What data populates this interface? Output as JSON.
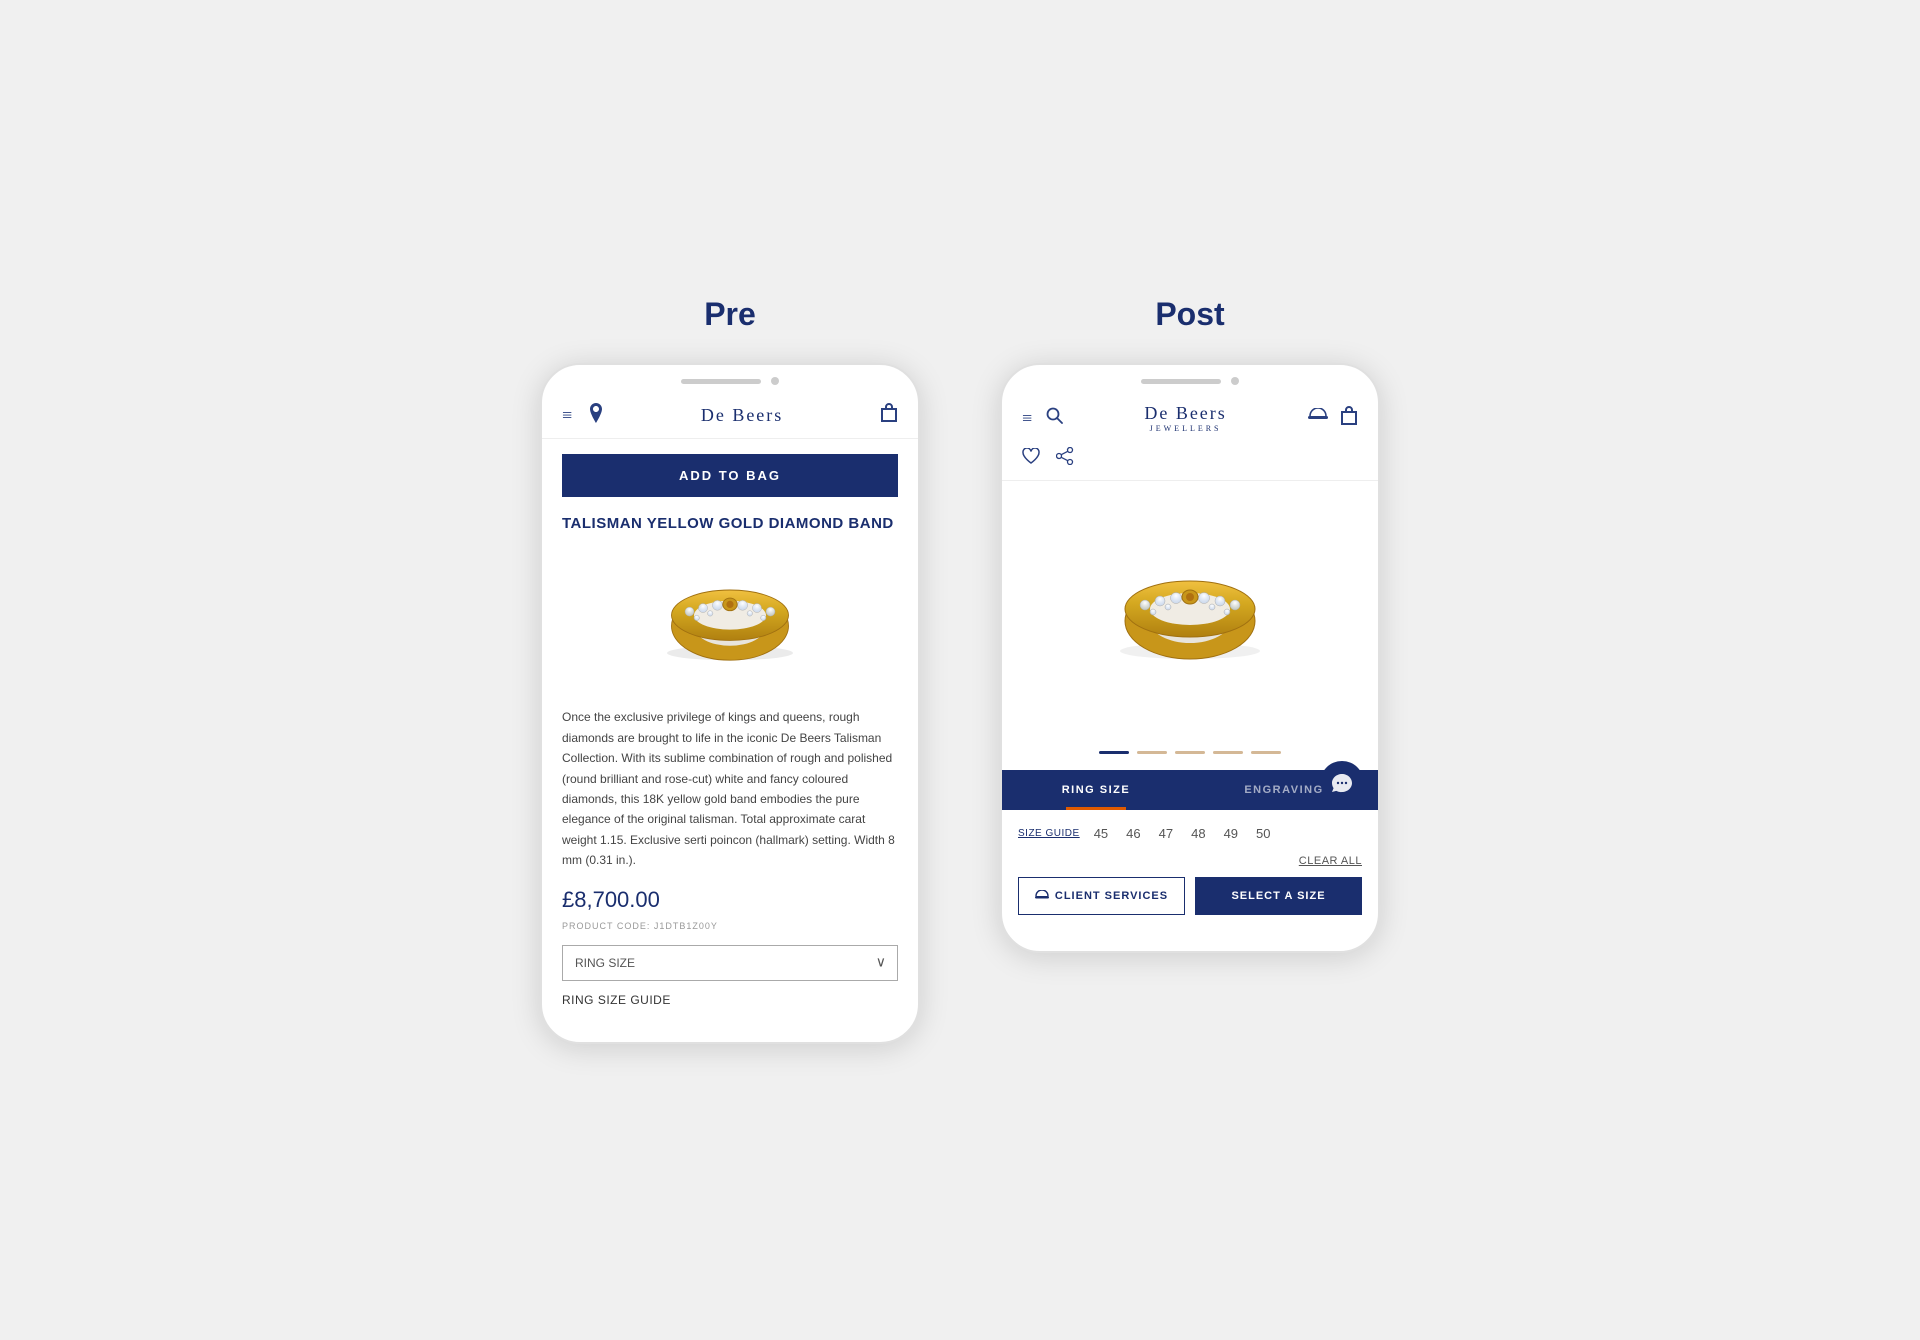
{
  "page": {
    "background": "#f0f0f0"
  },
  "pre": {
    "column_title": "Pre",
    "nav": {
      "brand": "De Beers",
      "icons_left": [
        "menu",
        "location"
      ],
      "icons_right": [
        "bag"
      ]
    },
    "add_to_bag_label": "ADD TO BAG",
    "product_title": "TALISMAN YELLOW GOLD DIAMOND BAND",
    "description": "Once the exclusive privilege of kings and queens, rough diamonds are brought to life in the iconic De Beers Talisman Collection. With its sublime combination of rough and polished (round brilliant and rose-cut) white and fancy coloured diamonds, this 18K yellow gold band embodies the pure elegance of the original talisman. Total approximate carat weight 1.15. Exclusive serti poincon (hallmark) setting. Width 8 mm (0.31 in.).",
    "price": "£8,700.00",
    "product_code_label": "PRODUCT CODE: J1DTB1Z00Y",
    "ring_size_label": "RING SIZE",
    "ring_size_guide": "RING SIZE GUIDE"
  },
  "post": {
    "column_title": "Post",
    "nav": {
      "brand": "De Beers",
      "brand_sub": "JEWELLERS",
      "icons_left": [
        "menu",
        "search"
      ],
      "icons_right": [
        "hat",
        "bag"
      ]
    },
    "sub_nav": {
      "icons": [
        "heart",
        "share"
      ]
    },
    "carousel_dots": [
      {
        "active": true
      },
      {
        "active": false
      },
      {
        "active": false
      },
      {
        "active": false
      },
      {
        "active": false
      }
    ],
    "tabs": [
      {
        "label": "RING SIZE",
        "active": true
      },
      {
        "label": "ENGRAVING",
        "active": false
      }
    ],
    "size_guide_label": "SIZE GUIDE",
    "sizes": [
      "45",
      "46",
      "47",
      "48",
      "49",
      "50"
    ],
    "clear_all_label": "CLEAR ALL",
    "client_services_label": "CLIENT SERVICES",
    "select_size_label": "SELECT A SIZE",
    "chat_icon": "💬"
  }
}
